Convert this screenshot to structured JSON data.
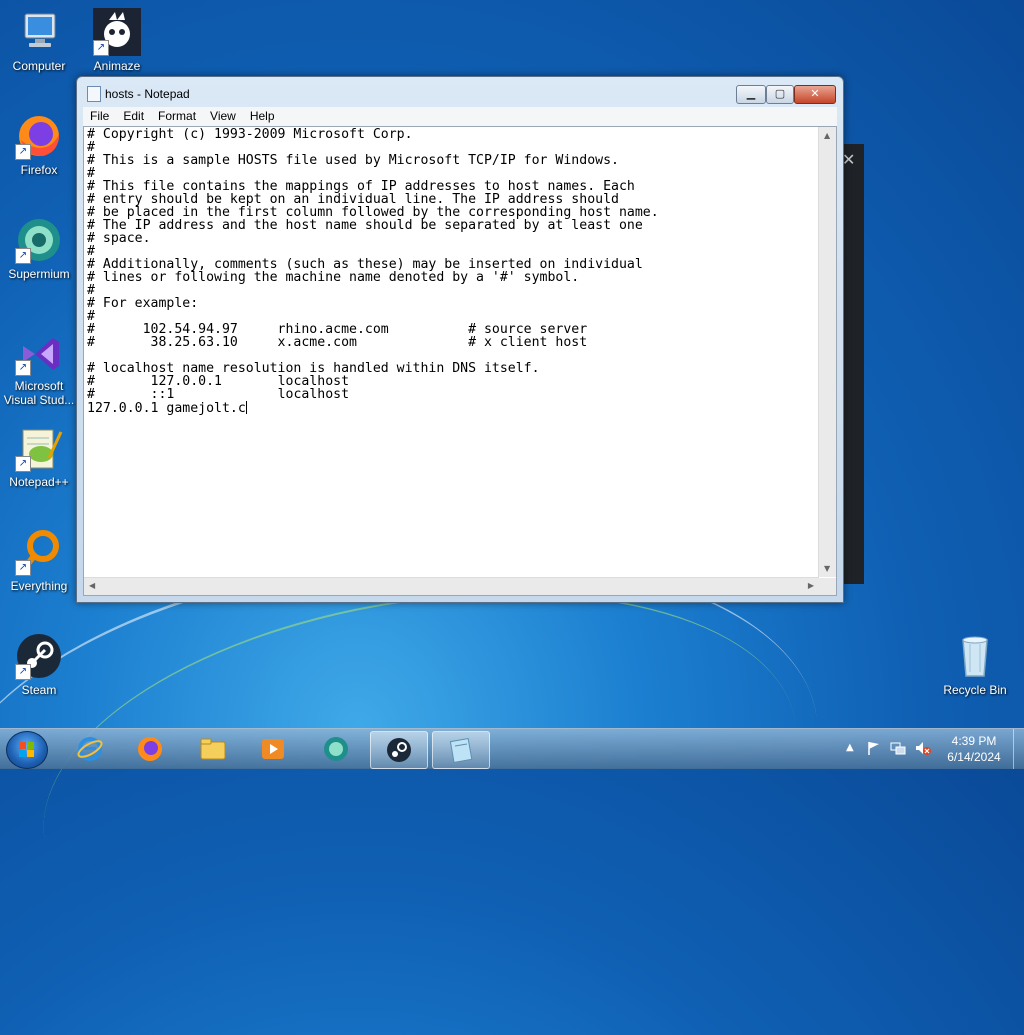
{
  "desktop": {
    "icons": [
      {
        "label": "Computer"
      },
      {
        "label": "Animaze"
      },
      {
        "label": "Firefox"
      },
      {
        "label": "Supermium"
      },
      {
        "label": "Microsoft Visual Stud..."
      },
      {
        "label": "Notepad++"
      },
      {
        "label": "Everything"
      },
      {
        "label": "Steam"
      },
      {
        "label": "Recycle Bin"
      }
    ]
  },
  "window": {
    "title": "hosts - Notepad",
    "menu": [
      "File",
      "Edit",
      "Format",
      "View",
      "Help"
    ],
    "content": "# Copyright (c) 1993-2009 Microsoft Corp.\n#\n# This is a sample HOSTS file used by Microsoft TCP/IP for Windows.\n#\n# This file contains the mappings of IP addresses to host names. Each\n# entry should be kept on an individual line. The IP address should\n# be placed in the first column followed by the corresponding host name.\n# The IP address and the host name should be separated by at least one\n# space.\n#\n# Additionally, comments (such as these) may be inserted on individual\n# lines or following the machine name denoted by a '#' symbol.\n#\n# For example:\n#\n#      102.54.94.97     rhino.acme.com          # source server\n#       38.25.63.10     x.acme.com              # x client host\n\n# localhost name resolution is handled within DNS itself.\n#\t127.0.0.1       localhost\n#\t::1             localhost\n127.0.0.1 gamejolt.c"
  },
  "taskbar": {
    "apps": [
      "internet-explorer",
      "firefox",
      "file-explorer",
      "media-player",
      "supermium",
      "steam",
      "notepad"
    ],
    "active_app": "notepad",
    "clock_time": "4:39 PM",
    "clock_date": "6/14/2024"
  },
  "colors": {
    "desktop_blue": "#0f5fb3",
    "close_red": "#c6452a"
  }
}
